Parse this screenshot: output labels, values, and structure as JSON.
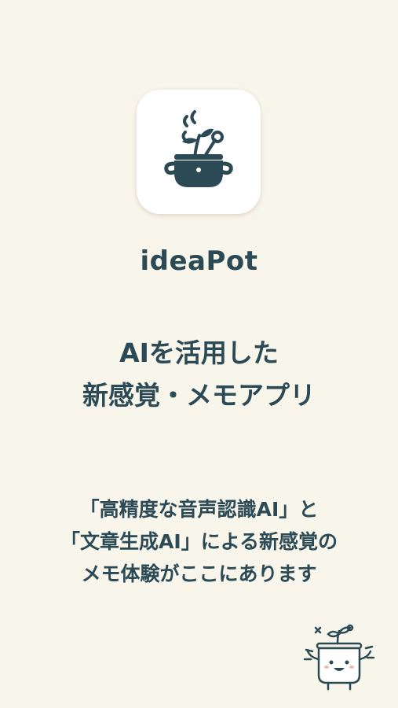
{
  "app": {
    "name": "ideaPot",
    "icon": "pot-with-sprout-icon",
    "accent_color": "#2b4a55",
    "background_color": "#f8f5ea"
  },
  "headline": {
    "line1": "AIを活用した",
    "line2": "新感覚・メモアプリ"
  },
  "description": {
    "line1": "「高精度な音声認識AI」と",
    "line2": "「文章生成AI」による新感覚の",
    "line3": "メモ体験がここにあります"
  },
  "mascot": {
    "icon": "happy-pot-mascot-icon"
  }
}
